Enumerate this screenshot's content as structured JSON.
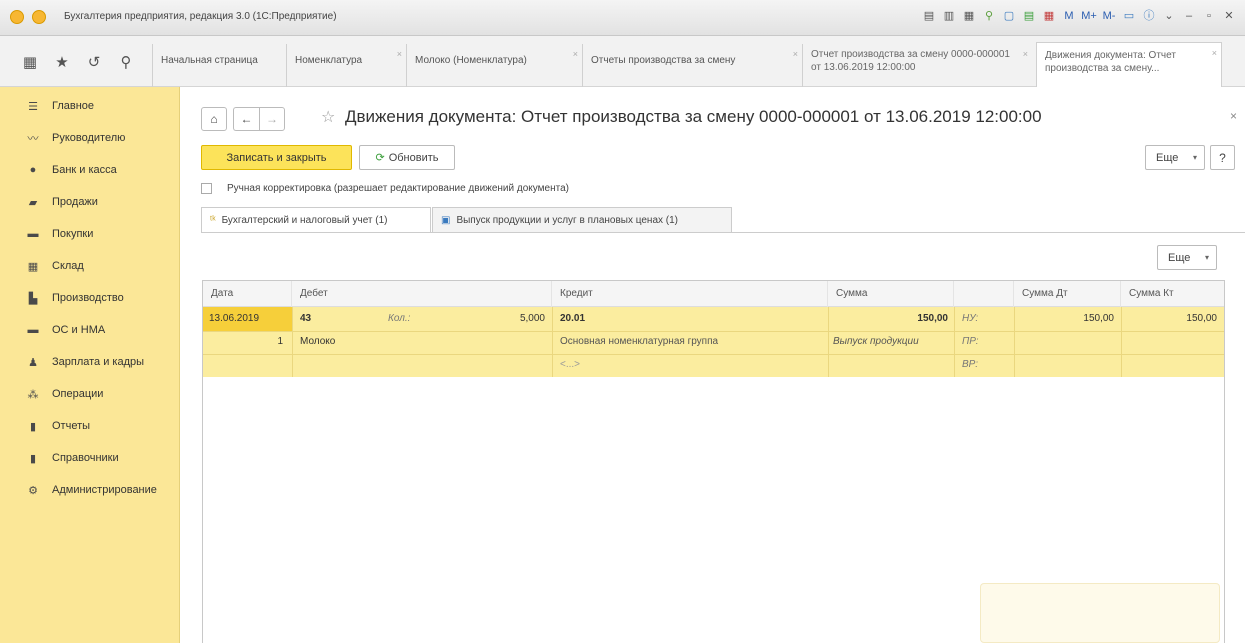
{
  "window": {
    "title": "Бухгалтерия предприятия, редакция 3.0 (1С:Предприятие)",
    "toolbar_labels": [
      "M",
      "M+",
      "M-"
    ]
  },
  "tabs": [
    {
      "label": "Начальная страница",
      "closable": false
    },
    {
      "label": "Номенклатура",
      "closable": true
    },
    {
      "label": "Молоко (Номенклатура)",
      "closable": true
    },
    {
      "label": "Отчеты производства за смену",
      "closable": true
    },
    {
      "label": "Отчет производства за смену 0000-000001 от 13.06.2019 12:00:00",
      "closable": true
    },
    {
      "label": "Движения документа: Отчет производства за смену...",
      "closable": true,
      "active": true
    }
  ],
  "sidebar": {
    "items": [
      {
        "label": "Главное",
        "icon": "menu-icon"
      },
      {
        "label": "Руководителю",
        "icon": "chart-line-icon"
      },
      {
        "label": "Банк и касса",
        "icon": "coins-icon"
      },
      {
        "label": "Продажи",
        "icon": "bag-icon"
      },
      {
        "label": "Покупки",
        "icon": "cart-icon"
      },
      {
        "label": "Склад",
        "icon": "warehouse-icon"
      },
      {
        "label": "Производство",
        "icon": "factory-icon"
      },
      {
        "label": "ОС и НМА",
        "icon": "truck-icon"
      },
      {
        "label": "Зарплата и кадры",
        "icon": "person-icon"
      },
      {
        "label": "Операции",
        "icon": "operations-icon"
      },
      {
        "label": "Отчеты",
        "icon": "bar-chart-icon"
      },
      {
        "label": "Справочники",
        "icon": "book-icon"
      },
      {
        "label": "Администрирование",
        "icon": "gear-icon"
      }
    ]
  },
  "document": {
    "title": "Движения документа: Отчет производства за смену 0000-000001 от 13.06.2019 12:00:00",
    "save_close_label": "Записать и закрыть",
    "refresh_label": "Обновить",
    "more_label": "Еще",
    "help_label": "?",
    "manual_edit_label": "Ручная корректировка (разрешает редактирование движений документа)",
    "manual_edit_checked": false,
    "doc_tabs": [
      {
        "label": "Бухгалтерский и налоговый учет (1)",
        "active": true
      },
      {
        "label": "Выпуск продукции и услуг в плановых ценах (1)",
        "active": false
      }
    ],
    "grid_more_label": "Еще"
  },
  "table": {
    "columns": [
      "Дата",
      "Дебет",
      "Кредит",
      "Сумма",
      "Сумма Дт",
      "Сумма Кт"
    ],
    "row": {
      "date": "13.06.2019",
      "line_no": "1",
      "debit_account": "43",
      "qty_label": "Кол.:",
      "qty_value": "5,000",
      "debit_subconto": "Молоко",
      "credit_account": "20.01",
      "credit_subconto1": "Основная номенклатурная группа",
      "credit_subconto2": "<...>",
      "amount": "150,00",
      "amount_subconto": "Выпуск продукции",
      "nu_label": "НУ:",
      "pr_label": "ПР:",
      "vr_label": "ВР:",
      "amount_dt": "150,00",
      "amount_kt": "150,00"
    }
  }
}
